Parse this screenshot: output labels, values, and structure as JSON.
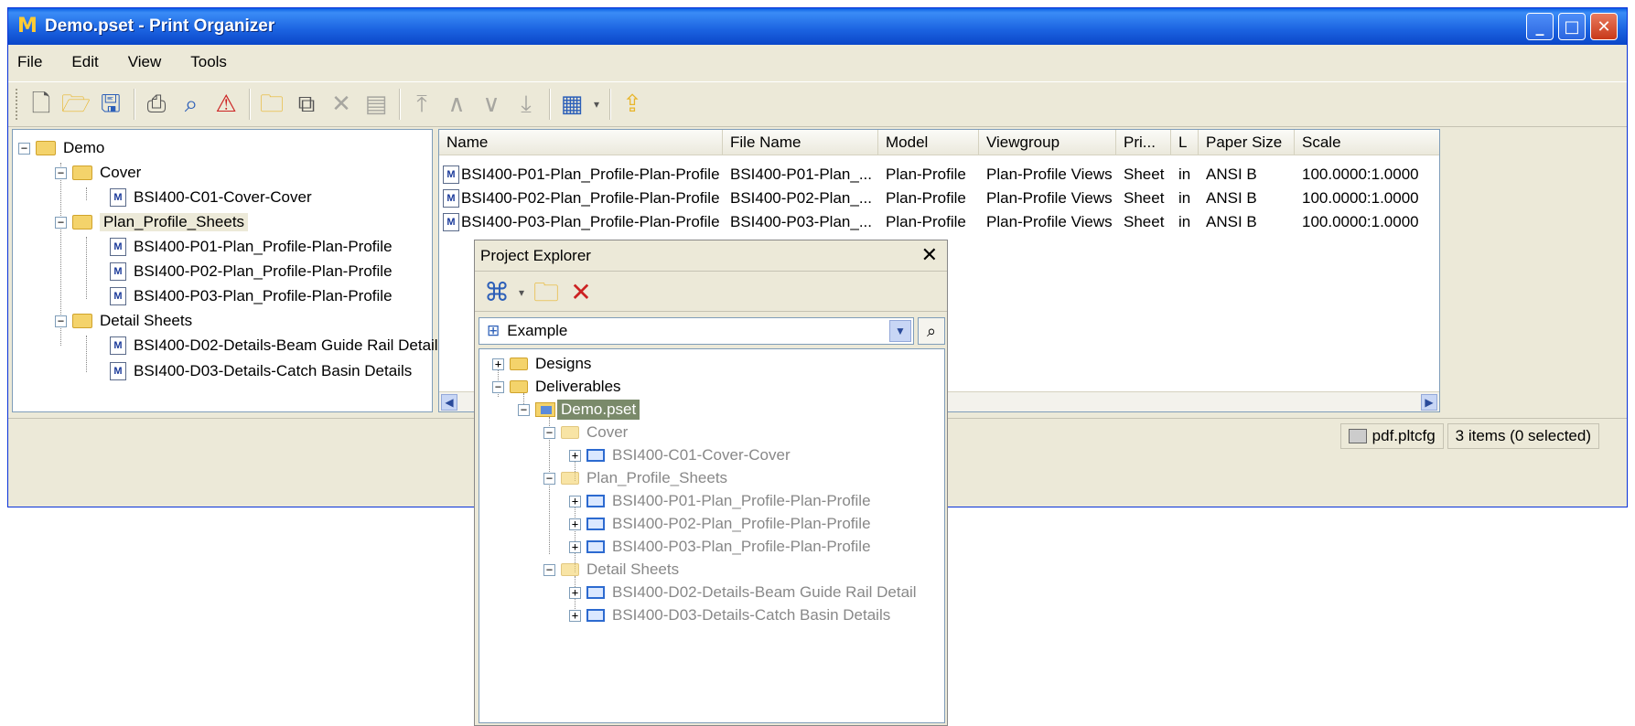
{
  "window": {
    "title": "Demo.pset - Print Organizer",
    "minimize": "_",
    "maximize": "□",
    "close": "✕"
  },
  "menu": [
    "File",
    "Edit",
    "View",
    "Tools"
  ],
  "toolbar": {
    "icons": [
      "new-icon",
      "open-icon",
      "save-icon",
      "print-icon",
      "preview-icon",
      "pdf-icon",
      "new-folder-icon",
      "add-files-icon",
      "delete-icon",
      "properties-icon",
      "move-top-icon",
      "move-up-icon",
      "move-down-icon",
      "move-bottom-icon",
      "display-icon",
      "up-level-icon"
    ]
  },
  "tree": {
    "root": "Demo",
    "items": [
      {
        "label": "Cover"
      },
      {
        "label": "BSI400-C01-Cover-Cover"
      },
      {
        "label": "Plan_Profile_Sheets"
      },
      {
        "label": "BSI400-P01-Plan_Profile-Plan-Profile"
      },
      {
        "label": "BSI400-P02-Plan_Profile-Plan-Profile"
      },
      {
        "label": "BSI400-P03-Plan_Profile-Plan-Profile"
      },
      {
        "label": "Detail Sheets"
      },
      {
        "label": "BSI400-D02-Details-Beam Guide Rail Detail"
      },
      {
        "label": "BSI400-D03-Details-Catch Basin Details"
      }
    ]
  },
  "list": {
    "columns": [
      "Name",
      "File Name",
      "Model",
      "Viewgroup",
      "Pri...",
      "L",
      "Paper Size",
      "Scale"
    ],
    "rows": [
      [
        "BSI400-P01-Plan_Profile-Plan-Profile",
        "BSI400-P01-Plan_...",
        "Plan-Profile",
        "Plan-Profile Views",
        "Sheet",
        "in",
        "ANSI B",
        "100.0000:1.0000"
      ],
      [
        "BSI400-P02-Plan_Profile-Plan-Profile",
        "BSI400-P02-Plan_...",
        "Plan-Profile",
        "Plan-Profile Views",
        "Sheet",
        "in",
        "ANSI B",
        "100.0000:1.0000"
      ],
      [
        "BSI400-P03-Plan_Profile-Plan-Profile",
        "BSI400-P03-Plan_...",
        "Plan-Profile",
        "Plan-Profile Views",
        "Sheet",
        "in",
        "ANSI B",
        "100.0000:1.0000"
      ]
    ]
  },
  "status": {
    "printer_driver": "pdf.pltcfg",
    "items": "3 items (0 selected)"
  },
  "project_explorer": {
    "title": "Project Explorer",
    "close": "✕",
    "selector_value": "Example",
    "tree": [
      {
        "label": "Designs"
      },
      {
        "label": "Deliverables"
      },
      {
        "label": "Demo.pset"
      },
      {
        "label": "Cover"
      },
      {
        "label": "BSI400-C01-Cover-Cover"
      },
      {
        "label": "Plan_Profile_Sheets"
      },
      {
        "label": "BSI400-P01-Plan_Profile-Plan-Profile"
      },
      {
        "label": "BSI400-P02-Plan_Profile-Plan-Profile"
      },
      {
        "label": "BSI400-P03-Plan_Profile-Plan-Profile"
      },
      {
        "label": "Detail Sheets"
      },
      {
        "label": "BSI400-D02-Details-Beam Guide Rail Detail"
      },
      {
        "label": "BSI400-D03-Details-Catch Basin Details"
      }
    ]
  },
  "colors": {
    "titlebar": "#1b62e0",
    "window_bg": "#ece9d8",
    "selection": "#7a8a6a"
  }
}
